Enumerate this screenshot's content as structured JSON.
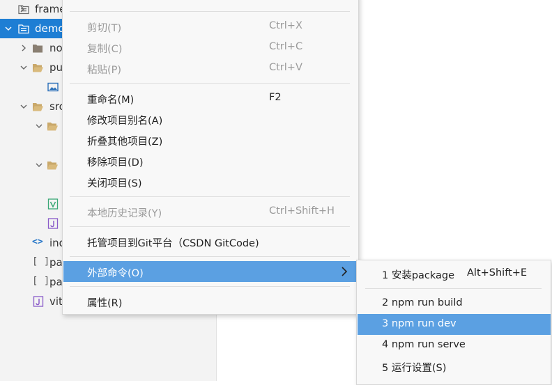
{
  "tree": {
    "items": [
      {
        "label": "frame",
        "icon": "folder-doc-icon"
      },
      {
        "label": "demo",
        "icon": "folder-doc-icon"
      },
      {
        "label": "no",
        "icon": "folder-icon"
      },
      {
        "label": "pu",
        "icon": "folder-open-icon"
      },
      {
        "label": "",
        "icon": "image-file-icon"
      },
      {
        "label": "src",
        "icon": "folder-open-icon"
      },
      {
        "label": "",
        "icon": "folder-open-icon"
      },
      {
        "label": "",
        "icon": "folder-open-icon"
      },
      {
        "label": "",
        "icon": "vue-file-icon"
      },
      {
        "label": "",
        "icon": "js-file-icon"
      },
      {
        "label": "ind",
        "icon": "html-file-icon"
      },
      {
        "label": "pa",
        "icon": "json-file-icon"
      },
      {
        "label": "pa",
        "icon": "json-file-icon"
      },
      {
        "label": "vit",
        "icon": "js-file-icon"
      }
    ]
  },
  "context_menu": {
    "top_partial_label": "",
    "items": [
      {
        "label": "剪切(T)",
        "shortcut": "Ctrl+X",
        "disabled": true
      },
      {
        "label": "复制(C)",
        "shortcut": "Ctrl+C",
        "disabled": true
      },
      {
        "label": "粘贴(P)",
        "shortcut": "Ctrl+V",
        "disabled": true
      },
      {
        "label": "重命名(M)",
        "shortcut": "F2",
        "disabled": false
      },
      {
        "label": "修改项目别名(A)",
        "shortcut": "",
        "disabled": false
      },
      {
        "label": "折叠其他项目(Z)",
        "shortcut": "",
        "disabled": false
      },
      {
        "label": "移除项目(D)",
        "shortcut": "",
        "disabled": false
      },
      {
        "label": "关闭项目(S)",
        "shortcut": "",
        "disabled": false
      },
      {
        "label": "本地历史记录(Y)",
        "shortcut": "Ctrl+Shift+H",
        "disabled": true
      },
      {
        "label": "托管项目到Git平台（CSDN GitCode)",
        "shortcut": "",
        "disabled": false
      },
      {
        "label": "外部命令(O)",
        "shortcut": "",
        "disabled": false,
        "active": true
      },
      {
        "label": "属性(R)",
        "shortcut": "",
        "disabled": false
      }
    ]
  },
  "submenu": {
    "items": [
      {
        "label": "1 安装package",
        "shortcut": "Alt+Shift+E"
      },
      {
        "label": "2 npm run build",
        "shortcut": ""
      },
      {
        "label": "3 npm run dev",
        "shortcut": "",
        "active": true
      },
      {
        "label": "4 npm run serve",
        "shortcut": ""
      },
      {
        "label": "5 运行设置(S)",
        "shortcut": ""
      }
    ]
  },
  "colors": {
    "selection": "#1e7ed4",
    "menu_highlight": "#5ba0e2",
    "disabled_text": "#9a9a9a"
  }
}
